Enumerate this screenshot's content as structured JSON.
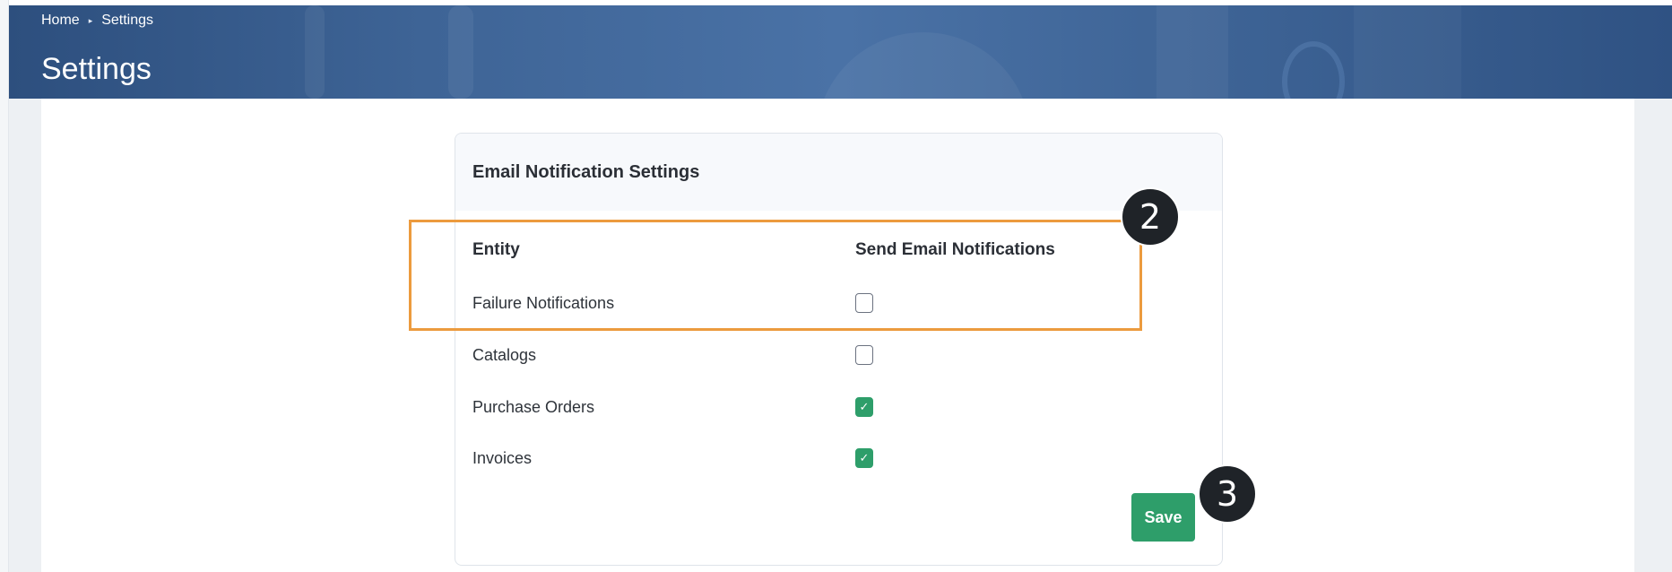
{
  "breadcrumb": {
    "home": "Home",
    "separator": "▸",
    "current": "Settings"
  },
  "page": {
    "title": "Settings"
  },
  "card": {
    "title": "Email Notification Settings",
    "columns": {
      "entity": "Entity",
      "send": "Send Email Notifications"
    },
    "rows": [
      {
        "entity": "Failure Notifications",
        "checked": false
      },
      {
        "entity": "Catalogs",
        "checked": false
      },
      {
        "entity": "Purchase Orders",
        "checked": true
      },
      {
        "entity": "Invoices",
        "checked": true
      }
    ],
    "check_glyph": "✓",
    "save_label": "Save"
  },
  "annotations": {
    "step2": "2",
    "step3": "3"
  },
  "colors": {
    "accent_green": "#2e9e6a",
    "highlight_orange": "#ec9b3e",
    "header_blue": "#3e6496"
  }
}
